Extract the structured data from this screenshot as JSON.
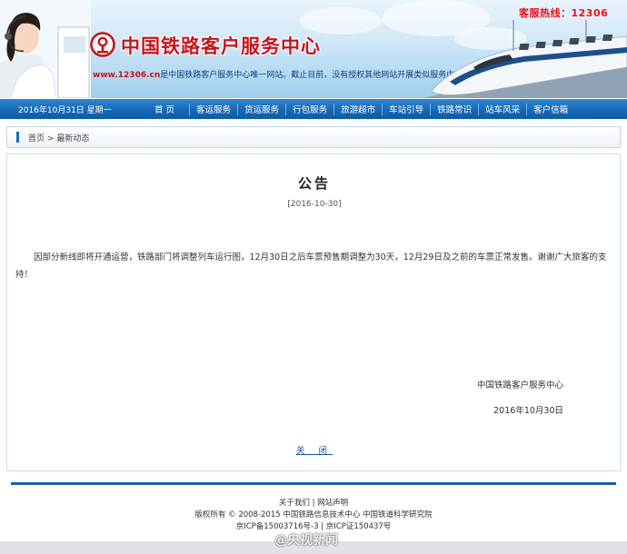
{
  "header": {
    "hotline": "客服热线：12306",
    "site_title": "中国铁路客户服务中心",
    "tagline_domain": "www.12306.cn",
    "tagline_text": "是中国铁路客户服务中心唯一网站。截止目前，没有授权其他网站开展类似服务内容。"
  },
  "nav": {
    "date": "2016年10月31日 星期一",
    "items": [
      "首 页",
      "客运服务",
      "货运服务",
      "行包服务",
      "旅游超市",
      "车站引导",
      "铁路常识",
      "站车风采",
      "客户信箱"
    ]
  },
  "breadcrumb": {
    "home": "首页",
    "separator": ">",
    "current": "最新动态"
  },
  "announcement": {
    "title": "公告",
    "date": "[2016-10-30]",
    "body": "因部分新线即将开通运营，铁路部门将调整列车运行图，12月30日之后车票预售期调整为30天，12月29日及之前的车票正常发售。谢谢广大旅客的支持！",
    "signature": "中国铁路客户服务中心",
    "sign_date": "2016年10月30日",
    "close_label": "关 闭"
  },
  "footer": {
    "link_about": "关于我们",
    "link_sep": "|",
    "link_statement": "网站声明",
    "copyright": "版权所有 © 2008-2015 中国铁路信息技术中心 中国铁道科学研究院",
    "icp": "京ICP备15003716号-3 | 京ICP证150437号"
  },
  "watermark": "@央视新闻",
  "colors": {
    "brand_red": "#c8141c",
    "nav_blue": "#1769b7",
    "link_blue": "#1a4fa0"
  }
}
